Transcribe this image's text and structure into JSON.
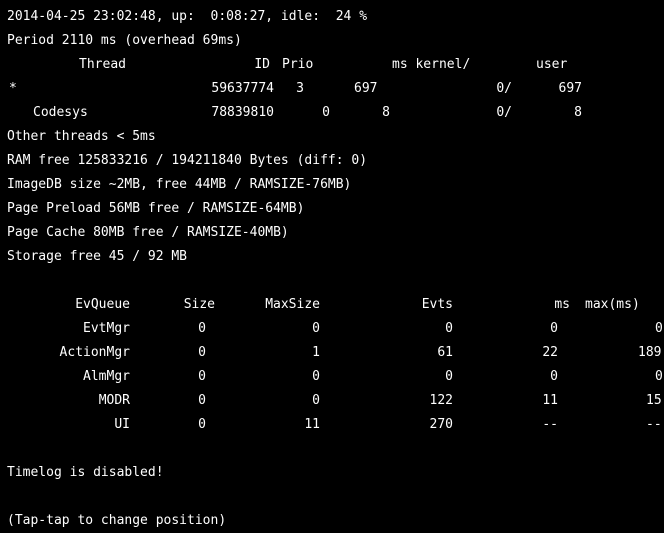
{
  "header": {
    "status_line": "2014-04-25 23:02:48, up:  0:08:27, idle:  24 %",
    "period_line": "Period 2110 ms (overhead 69ms)"
  },
  "threads": {
    "columns": [
      "Thread",
      "ID",
      "Prio",
      "ms kernel/",
      "user"
    ],
    "rows": [
      {
        "thread": "*",
        "id": "59637774",
        "prio": "3",
        "ms": "697",
        "kernel": "0/",
        "user": "697"
      },
      {
        "thread": "Codesys",
        "id": "78839810",
        "prio": "0",
        "ms": "8",
        "kernel": "0/",
        "user": "8"
      }
    ],
    "other_note": "Other threads < 5ms"
  },
  "memory": {
    "ram_line": "RAM free 125833216 / 194211840 Bytes (diff: 0)",
    "imagedb_line": "ImageDB size ~2MB, free 44MB / RAMSIZE-76MB)",
    "preload_line": "Page Preload 56MB free / RAMSIZE-64MB)",
    "cache_line": "Page Cache 80MB free / RAMSIZE-40MB)",
    "storage_line": "Storage free 45 / 92 MB"
  },
  "evqueue": {
    "columns": [
      "EvQueue",
      "Size",
      "MaxSize",
      "Evts",
      "ms",
      "max(ms)"
    ],
    "rows": [
      {
        "name": "EvtMgr",
        "size": "0",
        "maxsize": "0",
        "evts": "0",
        "ms": "0",
        "maxms": "0"
      },
      {
        "name": "ActionMgr",
        "size": "0",
        "maxsize": "1",
        "evts": "61",
        "ms": "22",
        "maxms": "189"
      },
      {
        "name": "AlmMgr",
        "size": "0",
        "maxsize": "0",
        "evts": "0",
        "ms": "0",
        "maxms": "0"
      },
      {
        "name": "MODR",
        "size": "0",
        "maxsize": "0",
        "evts": "122",
        "ms": "11",
        "maxms": "15"
      },
      {
        "name": "UI",
        "size": "0",
        "maxsize": "11",
        "evts": "270",
        "ms": "--",
        "maxms": "--"
      }
    ]
  },
  "footer": {
    "timelog": "Timelog is disabled!",
    "hint": "(Tap-tap to change position)"
  }
}
